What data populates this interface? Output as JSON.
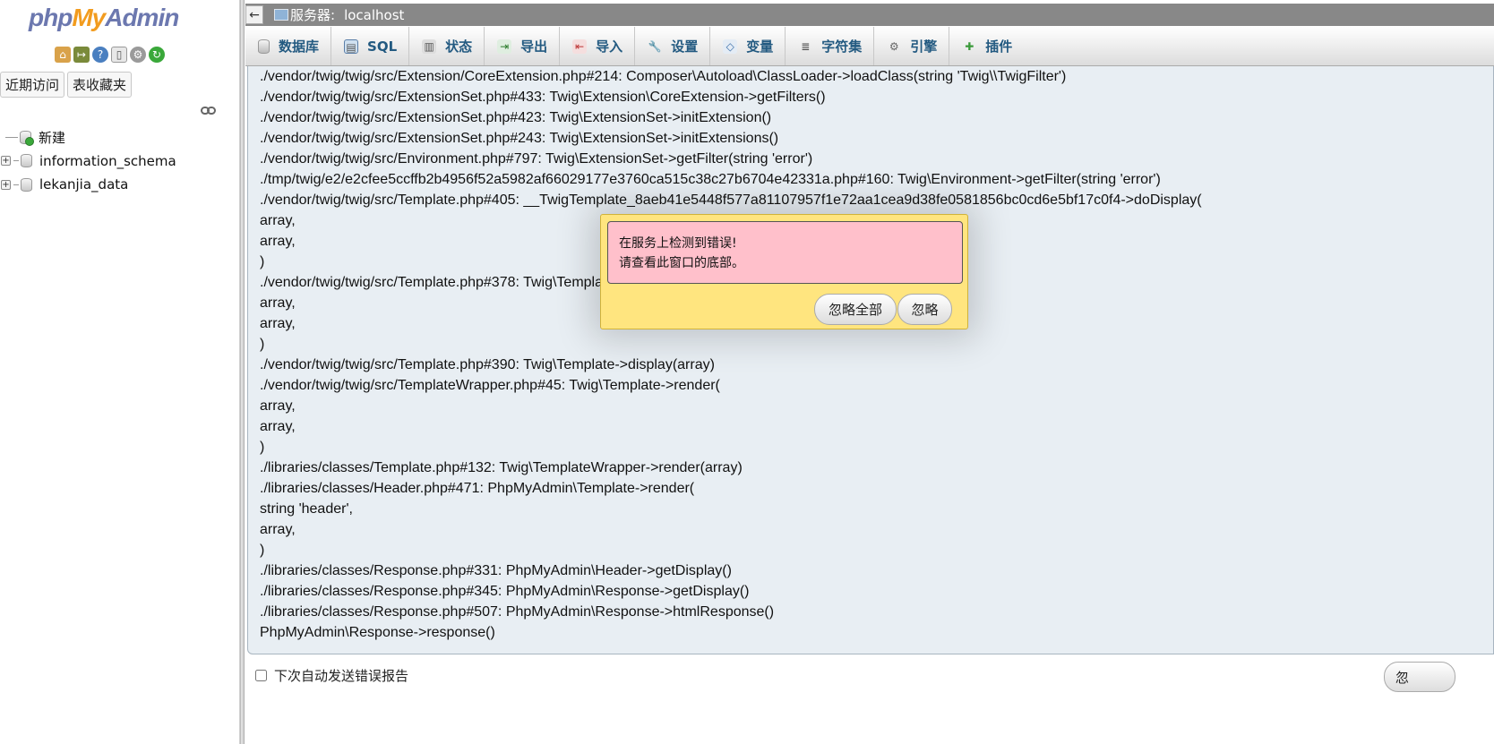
{
  "nav": {
    "logo": {
      "php": "php",
      "my": "My",
      "admin": "Admin"
    },
    "icons": [
      "home-icon",
      "exit-icon",
      "help-icon",
      "docs-icon",
      "settings-icon",
      "reload-icon"
    ],
    "tabs": [
      "近期访问",
      "表收藏夹"
    ],
    "tree": [
      {
        "label": "新建",
        "type": "new"
      },
      {
        "label": "information_schema",
        "type": "db"
      },
      {
        "label": "lekanjia_data",
        "type": "db"
      }
    ]
  },
  "serverbar": {
    "collapse": "←",
    "label": "服务器:",
    "host": "localhost"
  },
  "topmenu": {
    "tabs": [
      {
        "label": "数据库",
        "icon": "database-icon"
      },
      {
        "label": "SQL",
        "icon": "sql-icon"
      },
      {
        "label": "状态",
        "icon": "status-icon"
      },
      {
        "label": "导出",
        "icon": "export-icon"
      },
      {
        "label": "导入",
        "icon": "import-icon"
      },
      {
        "label": "设置",
        "icon": "wrench-icon"
      },
      {
        "label": "变量",
        "icon": "variables-icon"
      },
      {
        "label": "字符集",
        "icon": "charset-icon"
      },
      {
        "label": "引擎",
        "icon": "engine-icon"
      },
      {
        "label": "插件",
        "icon": "plugin-icon"
      }
    ]
  },
  "trace": {
    "lines": [
      "./vendor/twig/twig/src/Extension/CoreExtension.php#214: Composer\\Autoload\\ClassLoader->loadClass(string 'Twig\\\\TwigFilter')",
      "./vendor/twig/twig/src/ExtensionSet.php#433: Twig\\Extension\\CoreExtension->getFilters()",
      "./vendor/twig/twig/src/ExtensionSet.php#423: Twig\\ExtensionSet->initExtension()",
      "./vendor/twig/twig/src/ExtensionSet.php#243: Twig\\ExtensionSet->initExtensions()",
      "./vendor/twig/twig/src/Environment.php#797: Twig\\ExtensionSet->getFilter(string 'error')",
      "./tmp/twig/e2/e2cfee5ccffb2b4956f52a5982af66029177e3760ca515c38c27b6704e42331a.php#160: Twig\\Environment->getFilter(string 'error')",
      "./vendor/twig/twig/src/Template.php#405: __TwigTemplate_8aeb41e5448f577a81107957f1e72aa1cea9d38fe0581856bc0cd6e5bf17c0f4->doDisplay(",
      "array,",
      "array,",
      ")",
      "./vendor/twig/twig/src/Template.php#378: Twig\\Template->displayBlock(",
      "array,",
      "array,",
      ")",
      "./vendor/twig/twig/src/Template.php#390: Twig\\Template->display(array)",
      "./vendor/twig/twig/src/TemplateWrapper.php#45: Twig\\Template->render(",
      "array,",
      "array,",
      ")",
      "./libraries/classes/Template.php#132: Twig\\TemplateWrapper->render(array)",
      "./libraries/classes/Header.php#471: PhpMyAdmin\\Template->render(",
      "string 'header',",
      "array,",
      ")",
      "./libraries/classes/Response.php#331: PhpMyAdmin\\Header->getDisplay()",
      "./libraries/classes/Response.php#345: PhpMyAdmin\\Response->getDisplay()",
      "./libraries/classes/Response.php#507: PhpMyAdmin\\Response->htmlResponse()",
      "PhpMyAdmin\\Response->response()"
    ]
  },
  "bottom": {
    "auto_report_label": "下次自动发送错误报告",
    "ignore_all_partial": "忽"
  },
  "dialog": {
    "line1": "在服务上检测到错误!",
    "line2": "请查看此窗口的底部。",
    "ignore_all": "忽略全部",
    "ignore": "忽略"
  },
  "colors": {
    "dialog_bg": "#ffe57f",
    "dialog_msg_bg": "#ffc0cb",
    "menu_text": "#235a81",
    "serverbar_bg": "#888888",
    "trace_bg": "#e8eef3"
  }
}
